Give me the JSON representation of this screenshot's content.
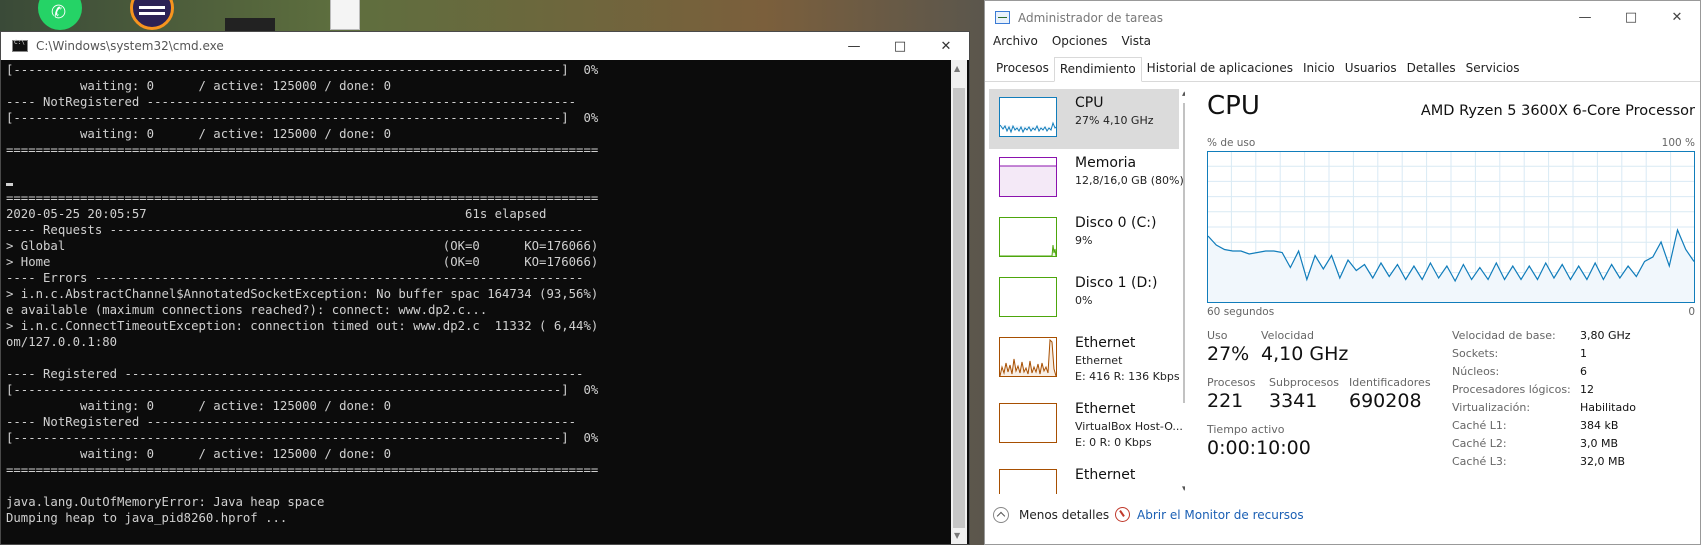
{
  "desktop": {
    "icons": [
      "whatsapp-icon",
      "eclipse-icon",
      "dark-window-icon",
      "document-icon"
    ]
  },
  "cmd": {
    "title": "C:\\Windows\\system32\\cmd.exe",
    "lines_top": [
      "[--------------------------------------------------------------------------]  0%",
      "          waiting: 0      / active: 125000 / done: 0",
      "---- NotRegistered ----------------------------------------------------------",
      "[--------------------------------------------------------------------------]  0%",
      "          waiting: 0      / active: 125000 / done: 0",
      "================================================================================",
      "",
      ""
    ],
    "lines_bottom": [
      "================================================================================",
      "2020-05-25 20:05:57                                           61s elapsed",
      "---- Requests ----------------------------------------------------------------",
      "> Global                                                   (OK=0      KO=176066)",
      "> Home                                                     (OK=0      KO=176066)",
      "---- Errors ------------------------------------------------------------------",
      "> i.n.c.AbstractChannel$AnnotatedSocketException: No buffer spac 164734 (93,56%)",
      "e available (maximum connections reached?): connect: www.dp2.c...",
      "> i.n.c.ConnectTimeoutException: connection timed out: www.dp2.c  11332 ( 6,44%)",
      "om/127.0.0.1:80",
      "",
      "---- Registered --------------------------------------------------------------",
      "[--------------------------------------------------------------------------]  0%",
      "          waiting: 0      / active: 125000 / done: 0",
      "---- NotRegistered ----------------------------------------------------------",
      "[--------------------------------------------------------------------------]  0%",
      "          waiting: 0      / active: 125000 / done: 0",
      "================================================================================",
      "",
      "java.lang.OutOfMemoryError: Java heap space",
      "Dumping heap to java_pid8260.hprof ..."
    ]
  },
  "taskmgr": {
    "title": "Administrador de tareas",
    "menu": [
      "Archivo",
      "Opciones",
      "Vista"
    ],
    "tabs": [
      "Procesos",
      "Rendimiento",
      "Historial de aplicaciones",
      "Inicio",
      "Usuarios",
      "Detalles",
      "Servicios"
    ],
    "active_tab": "Rendimiento",
    "sidebar": [
      {
        "name": "CPU",
        "sub": "27% 4,10 GHz",
        "sub2": "",
        "color": "#117dbb",
        "selected": true
      },
      {
        "name": "Memoria",
        "sub": "12,8/16,0 GB (80%)",
        "sub2": "",
        "color": "#8b12ae",
        "selected": false
      },
      {
        "name": "Disco 0 (C:)",
        "sub": "9%",
        "sub2": "",
        "color": "#4da60c",
        "selected": false
      },
      {
        "name": "Disco 1 (D:)",
        "sub": "0%",
        "sub2": "",
        "color": "#4da60c",
        "selected": false
      },
      {
        "name": "Ethernet",
        "sub": "Ethernet",
        "sub2": "E: 416  R: 136 Kbps",
        "color": "#a74f01",
        "selected": false
      },
      {
        "name": "Ethernet",
        "sub": "VirtualBox Host-O...",
        "sub2": "E: 0  R: 0 Kbps",
        "color": "#a74f01",
        "selected": false
      },
      {
        "name": "Ethernet",
        "sub": "",
        "sub2": "",
        "color": "#a74f01",
        "selected": false
      }
    ],
    "cpu": {
      "title": "CPU",
      "processor": "AMD Ryzen 5 3600X 6-Core Processor",
      "y_label": "% de uso",
      "y_max_label": "100 %",
      "x_label": "60 segundos",
      "x_end_label": "0",
      "usage_label": "Uso",
      "usage": "27%",
      "speed_label": "Velocidad",
      "speed": "4,10 GHz",
      "procs_label": "Procesos",
      "procs": "221",
      "threads_label": "Subprocesos",
      "threads": "3341",
      "handles_label": "Identificadores",
      "handles": "690208",
      "uptime_label": "Tiempo activo",
      "uptime": "0:00:10:00",
      "specs": [
        {
          "k": "Velocidad de base:",
          "v": "3,80 GHz"
        },
        {
          "k": "Sockets:",
          "v": "1"
        },
        {
          "k": "Núcleos:",
          "v": "6"
        },
        {
          "k": "Procesadores lógicos:",
          "v": "12"
        },
        {
          "k": "Virtualización:",
          "v": "Habilitado"
        },
        {
          "k": "Caché L1:",
          "v": "384 kB"
        },
        {
          "k": "Caché L2:",
          "v": "3,0 MB"
        },
        {
          "k": "Caché L3:",
          "v": "32,0 MB"
        }
      ]
    },
    "footer": {
      "less_details": "Menos detalles",
      "resource_monitor": "Abrir el Monitor de recursos"
    }
  },
  "chart_data": {
    "type": "line",
    "title": "CPU",
    "ylabel": "% de uso",
    "xlabel": "60 segundos",
    "ylim": [
      0,
      100
    ],
    "xlim": [
      60,
      0
    ],
    "series": [
      {
        "values": [
          44,
          38,
          35,
          34,
          34,
          32,
          33,
          34,
          34,
          33,
          23,
          34,
          15,
          31,
          22,
          31,
          16,
          28,
          21,
          25,
          16,
          26,
          17,
          25,
          15,
          24,
          15,
          26,
          16,
          24,
          14,
          25,
          15,
          23,
          15,
          26,
          15,
          24,
          15,
          24,
          15,
          26,
          16,
          25,
          15,
          24,
          15,
          26,
          15,
          25,
          16,
          24,
          17,
          27,
          30,
          40,
          24,
          48,
          35,
          27
        ]
      }
    ]
  }
}
